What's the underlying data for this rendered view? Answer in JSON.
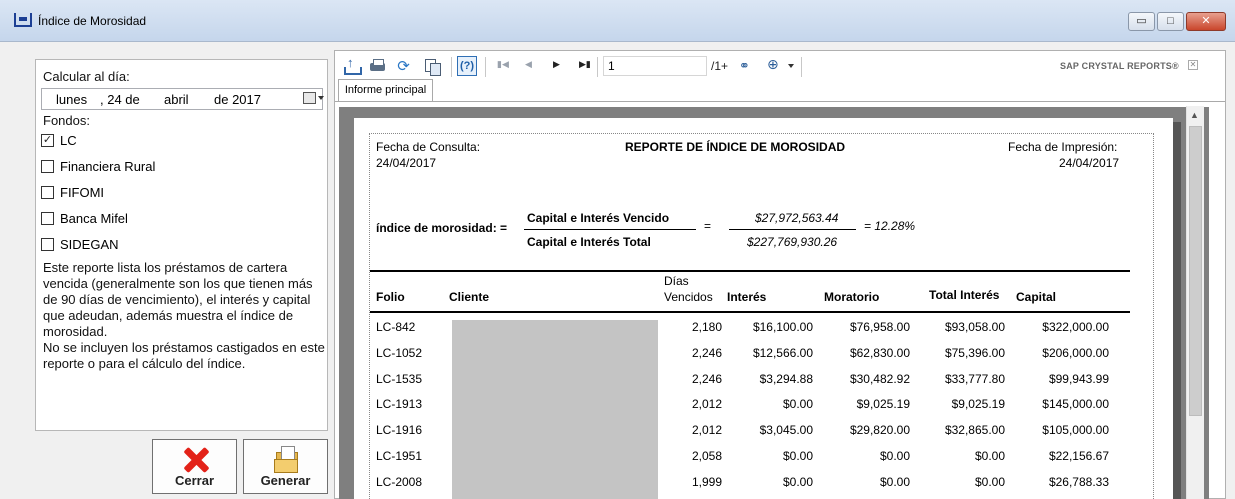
{
  "window": {
    "title": "Índice de Morosidad",
    "min": "▭",
    "max": "□",
    "close": "✕"
  },
  "left": {
    "calcular_label": "Calcular al día:",
    "date": {
      "weekday": "lunes",
      "day": ", 24 de",
      "month": "abril",
      "year": "de 2017"
    },
    "fondos_label": "Fondos:",
    "fondos": [
      {
        "label": "LC",
        "checked": "✓"
      },
      {
        "label": "Financiera Rural",
        "checked": ""
      },
      {
        "label": "FIFOMI",
        "checked": ""
      },
      {
        "label": "Banca Mifel",
        "checked": ""
      },
      {
        "label": "SIDEGAN",
        "checked": ""
      }
    ],
    "description": "Este reporte lista los préstamos de cartera vencida (generalmente son los que tienen más de 90 días de vencimiento), el interés y capital que adeudan, además muestra el índice de morosidad.",
    "description2": "No se incluyen los préstamos castigados en este reporte o para el cálculo del índice."
  },
  "buttons": {
    "cerrar": "Cerrar",
    "generar": "Generar"
  },
  "viewer": {
    "page_number": "1",
    "page_count": "/1+",
    "brand": "SAP CRYSTAL REPORTS®",
    "tab": "Informe principal"
  },
  "report": {
    "fecha_consulta_label": "Fecha de Consulta:",
    "fecha_consulta": "24/04/2017",
    "title": "REPORTE DE ÍNDICE DE MOROSIDAD",
    "fecha_impresion_label": "Fecha de Impresión:",
    "fecha_impresion": "24/04/2017",
    "indice_label": "índice de morosidad: =",
    "numerator_label": "Capital e Interés Vencido",
    "denominator_label": "Capital e Interés Total",
    "equals": "=",
    "numerator_value": "$27,972,563.44",
    "denominator_value": "$227,769,930.26",
    "result": "=  12.28%",
    "columns": {
      "folio": "Folio",
      "cliente": "Cliente",
      "dias1": "Días",
      "dias2": "Vencidos",
      "interes": "Interés",
      "moratorio": "Moratorio",
      "total_interes": "Total Interés",
      "capital": "Capital"
    },
    "rows": [
      {
        "folio": "LC-842",
        "dias": "2,180",
        "interes": "$16,100.00",
        "moratorio": "$76,958.00",
        "total": "$93,058.00",
        "capital": "$322,000.00"
      },
      {
        "folio": "LC-1052",
        "dias": "2,246",
        "interes": "$12,566.00",
        "moratorio": "$62,830.00",
        "total": "$75,396.00",
        "capital": "$206,000.00"
      },
      {
        "folio": "LC-1535",
        "dias": "2,246",
        "interes": "$3,294.88",
        "moratorio": "$30,482.92",
        "total": "$33,777.80",
        "capital": "$99,943.99"
      },
      {
        "folio": "LC-1913",
        "dias": "2,012",
        "interes": "$0.00",
        "moratorio": "$9,025.19",
        "total": "$9,025.19",
        "capital": "$145,000.00"
      },
      {
        "folio": "LC-1916",
        "dias": "2,012",
        "interes": "$3,045.00",
        "moratorio": "$29,820.00",
        "total": "$32,865.00",
        "capital": "$105,000.00"
      },
      {
        "folio": "LC-1951",
        "dias": "2,058",
        "interes": "$0.00",
        "moratorio": "$0.00",
        "total": "$0.00",
        "capital": "$22,156.67"
      },
      {
        "folio": "LC-2008",
        "dias": "1,999",
        "interes": "$0.00",
        "moratorio": "$0.00",
        "total": "$0.00",
        "capital": "$26,788.33"
      }
    ]
  }
}
